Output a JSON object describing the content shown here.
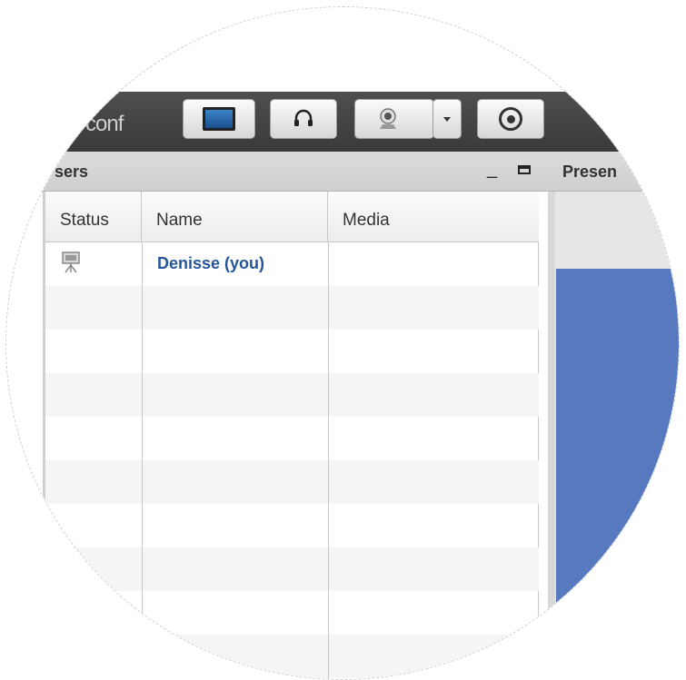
{
  "app": {
    "logo_text": "conf"
  },
  "toolbar": {
    "buttons": [
      {
        "name": "desktop-share",
        "icon": "monitor-icon"
      },
      {
        "name": "audio",
        "icon": "headset-icon"
      },
      {
        "name": "webcam",
        "icon": "webcam-icon"
      },
      {
        "name": "webcam-options",
        "icon": "caret-down-icon"
      },
      {
        "name": "record",
        "icon": "record-icon"
      }
    ]
  },
  "users_panel": {
    "title": "sers",
    "columns": [
      "Status",
      "Name",
      "Media"
    ],
    "rows": [
      {
        "status_icon": "presenter-icon",
        "name": "Denisse (you)",
        "media": ""
      }
    ]
  },
  "presentation_panel": {
    "title": "Presen"
  },
  "colors": {
    "toolbar": "#404040",
    "accent_name": "#25559a",
    "slide": "#5679bf"
  }
}
